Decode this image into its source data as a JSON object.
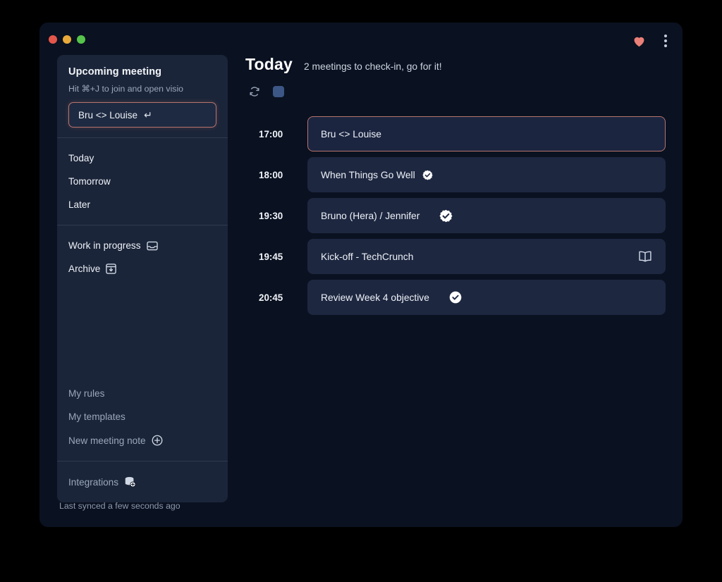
{
  "window": {
    "traffic_lights": [
      "close",
      "minimize",
      "zoom"
    ],
    "favorite_icon": "heart-icon",
    "menu_icon": "kebab-menu-icon",
    "accent_heart_color": "#eb8078",
    "accent_border_color": "#b8736e",
    "window_bg": "#0a1120",
    "sidebar_bg": "#1b2539",
    "card_bg": "#1d2740",
    "blue_square_color": "#3c5685"
  },
  "sidebar": {
    "upcoming": {
      "title": "Upcoming meeting",
      "hint": "Hit ⌘+J to join and open visio",
      "value": "Bru <> Louise",
      "enter_glyph": "↵",
      "enter_icon": "enter-key-icon"
    },
    "nav_primary": [
      {
        "label": "Today",
        "icon": null
      },
      {
        "label": "Tomorrow",
        "icon": null
      },
      {
        "label": "Later",
        "icon": null
      }
    ],
    "nav_secondary": [
      {
        "label": "Work in progress",
        "icon": "inbox-tray-icon"
      },
      {
        "label": "Archive",
        "icon": "archive-box-icon"
      }
    ],
    "nav_tertiary": [
      {
        "label": "My rules",
        "icon": null
      },
      {
        "label": "My templates",
        "icon": null
      },
      {
        "label": "New meeting note",
        "icon": "plus-circle-icon"
      }
    ],
    "nav_footer": [
      {
        "label": "Integrations",
        "icon": "integrations-database-icon"
      }
    ],
    "sync_status": "Last synced a few seconds ago"
  },
  "main": {
    "title": "Today",
    "subtitle": "2 meetings to check-in, go for it!",
    "toolbar": {
      "refresh_icon": "refresh-sync-icon",
      "color_swatch": "blue-square-button"
    },
    "meetings": [
      {
        "time": "17:00",
        "name": "Bru <> Louise",
        "selected": true,
        "badge": null,
        "right_icon": null,
        "badge_gap": false
      },
      {
        "time": "18:00",
        "name": "When Things Go Well",
        "selected": false,
        "badge": "verified-check-icon",
        "right_icon": null,
        "badge_gap": false
      },
      {
        "time": "19:30",
        "name": "Bruno (Hera) / Jennifer",
        "selected": false,
        "badge": "verified-check-icon",
        "right_icon": null,
        "badge_gap": true
      },
      {
        "time": "19:45",
        "name": "Kick-off - TechCrunch",
        "selected": false,
        "badge": null,
        "right_icon": "open-book-icon",
        "badge_gap": false
      },
      {
        "time": "20:45",
        "name": "Review Week 4 objective",
        "selected": false,
        "badge": "verified-check-icon",
        "right_icon": null,
        "badge_gap": true
      }
    ]
  }
}
